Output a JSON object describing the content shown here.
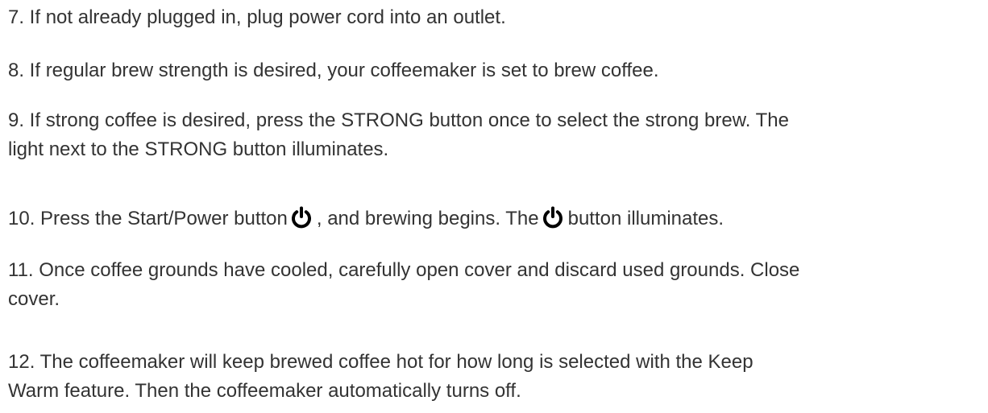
{
  "steps": {
    "s7": "7. If not already plugged in, plug power cord into an outlet.",
    "s8": "8. If regular brew strength is desired, your coffeemaker is set to brew coffee.",
    "s9_line1": "9. If strong coffee is desired, press the STRONG button once to select the strong brew. The",
    "s9_line2": "light next to the STRONG button illuminates.",
    "s10_part1": "10. Press the Start/Power button",
    "s10_part2": ", and brewing begins. The",
    "s10_part3": "button illuminates.",
    "s11_line1": "11. Once coffee grounds have cooled, carefully open cover and discard used grounds. Close",
    "s11_line2": "cover.",
    "s12_line1": "12. The coffeemaker will keep brewed coffee hot for how long is selected with the Keep",
    "s12_line2": "Warm feature. Then the coffeemaker automatically turns off."
  },
  "icons": {
    "power": "power-icon"
  },
  "colors": {
    "text": "#333333",
    "icon": "#000000"
  }
}
